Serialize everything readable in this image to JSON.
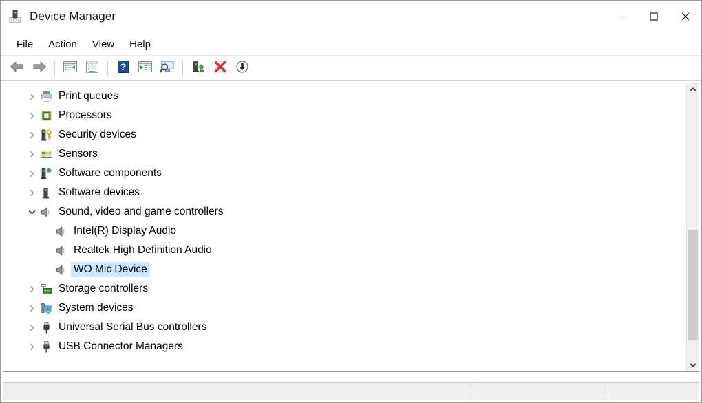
{
  "window": {
    "title": "Device Manager",
    "icon": "device-manager-icon",
    "controls": [
      {
        "name": "minimize-button",
        "glyph": "minimize"
      },
      {
        "name": "maximize-button",
        "glyph": "maximize"
      },
      {
        "name": "close-button",
        "glyph": "close"
      }
    ]
  },
  "menubar": {
    "items": [
      {
        "label": "File"
      },
      {
        "label": "Action"
      },
      {
        "label": "View"
      },
      {
        "label": "Help"
      }
    ]
  },
  "toolbar": {
    "buttons": [
      {
        "name": "back-button",
        "icon": "back-arrow-icon",
        "title": "Back"
      },
      {
        "name": "forward-button",
        "icon": "forward-arrow-icon",
        "title": "Forward"
      },
      {
        "name": "separator-1",
        "icon": "separator"
      },
      {
        "name": "show-hide-console-tree-button",
        "icon": "console-tree-icon",
        "title": "Show/Hide Console Tree"
      },
      {
        "name": "properties-button",
        "icon": "properties-icon",
        "title": "Properties"
      },
      {
        "name": "separator-2",
        "icon": "separator"
      },
      {
        "name": "help-button",
        "icon": "help-question-icon",
        "title": "Help"
      },
      {
        "name": "update-driver-software-button",
        "icon": "play-window-icon",
        "title": "Update Driver"
      },
      {
        "name": "scan-for-hardware-changes-button",
        "icon": "monitor-search-icon",
        "title": "Scan for hardware changes"
      },
      {
        "name": "separator-3",
        "icon": "separator"
      },
      {
        "name": "update-device-driver-button",
        "icon": "device-up-arrow-icon",
        "title": "Update device driver"
      },
      {
        "name": "uninstall-device-button",
        "icon": "red-x-icon",
        "title": "Uninstall device"
      },
      {
        "name": "disable-device-button",
        "icon": "circle-down-arrow-icon",
        "title": "Disable device"
      }
    ]
  },
  "tree": {
    "rows": [
      {
        "label": "Print queues",
        "icon": "printer-icon",
        "indent": 0,
        "expander": "collapsed",
        "selected": false
      },
      {
        "label": "Processors",
        "icon": "cpu-chip-icon",
        "indent": 0,
        "expander": "collapsed",
        "selected": false
      },
      {
        "label": "Security devices",
        "icon": "security-key-icon",
        "indent": 0,
        "expander": "collapsed",
        "selected": false
      },
      {
        "label": "Sensors",
        "icon": "sensors-grid-icon",
        "indent": 0,
        "expander": "collapsed",
        "selected": false
      },
      {
        "label": "Software components",
        "icon": "software-component-icon",
        "indent": 0,
        "expander": "collapsed",
        "selected": false
      },
      {
        "label": "Software devices",
        "icon": "software-device-icon",
        "indent": 0,
        "expander": "collapsed",
        "selected": false
      },
      {
        "label": "Sound, video and game controllers",
        "icon": "speaker-icon",
        "indent": 0,
        "expander": "expanded",
        "selected": false
      },
      {
        "label": "Intel(R) Display Audio",
        "icon": "speaker-icon",
        "indent": 1,
        "expander": "none",
        "selected": false
      },
      {
        "label": "Realtek High Definition Audio",
        "icon": "speaker-icon",
        "indent": 1,
        "expander": "none",
        "selected": false
      },
      {
        "label": "WO Mic Device",
        "icon": "speaker-icon",
        "indent": 1,
        "expander": "none",
        "selected": true
      },
      {
        "label": "Storage controllers",
        "icon": "storage-controller-icon",
        "indent": 0,
        "expander": "collapsed",
        "selected": false
      },
      {
        "label": "System devices",
        "icon": "system-device-icon",
        "indent": 0,
        "expander": "collapsed",
        "selected": false
      },
      {
        "label": "Universal Serial Bus controllers",
        "icon": "usb-plug-icon",
        "indent": 0,
        "expander": "collapsed",
        "selected": false
      },
      {
        "label": "USB Connector Managers",
        "icon": "usb-plug-icon",
        "indent": 0,
        "expander": "collapsed",
        "selected": false
      }
    ]
  },
  "scrollbar": {
    "up_icon": "chevron-up-icon",
    "down_icon": "chevron-down-icon",
    "thumb_top_percent": 51,
    "thumb_height_percent": 42
  },
  "statusbar": {
    "panes": [
      "",
      "",
      ""
    ]
  },
  "colors": {
    "selection": "#cce8ff",
    "window_background": "#ffffff",
    "status_background": "#efefef",
    "scrollbar_thumb": "#cdcdcd",
    "accent_red": "#e03030",
    "accent_green": "#3eaa35",
    "accent_blue": "#1b5fbe"
  }
}
